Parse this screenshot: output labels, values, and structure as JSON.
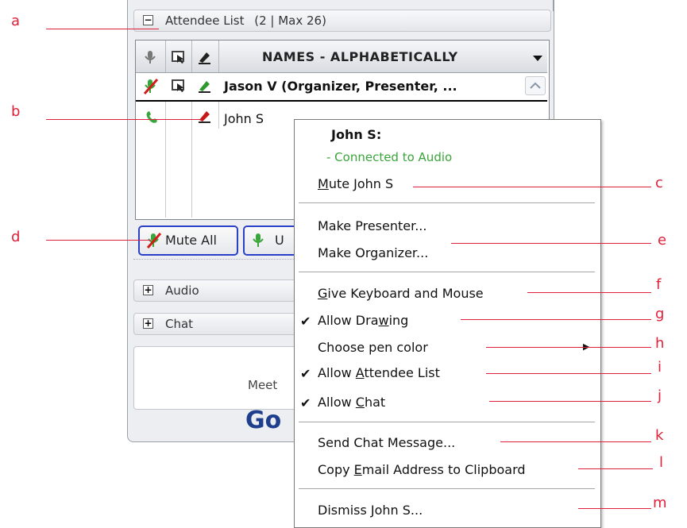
{
  "attendee_panel": {
    "section_title": "Attendee List",
    "count_text": "(2 | Max 26)",
    "collapse_symbol": "−",
    "columns": {
      "names_header": "NAMES - ALPHABETICALLY"
    },
    "rows": [
      {
        "name": "Jason V (Organizer, Presenter, ..."
      },
      {
        "name": "John S"
      }
    ],
    "buttons": {
      "mute_all": "Mute All",
      "unmute_partial": "U"
    },
    "sections": [
      {
        "label": "Audio",
        "symbol": "+"
      },
      {
        "label": "Chat",
        "symbol": "+"
      }
    ],
    "footer_text": "Meet",
    "brand_text": "Go"
  },
  "context_menu": {
    "title": "John S:",
    "status": "- Connected to Audio",
    "items": {
      "mute": {
        "pre": "",
        "ul": "M",
        "post": "ute John S"
      },
      "make_presenter": "Make Presenter...",
      "make_organizer": "Make Organizer...",
      "give_keyboard": {
        "pre": "",
        "ul": "G",
        "post": "ive Keyboard and Mouse"
      },
      "allow_drawing": {
        "pre": "Allow Dra",
        "ul": "w",
        "post": "ing",
        "checked": true
      },
      "choose_pen": "Choose pen color",
      "allow_attendee": {
        "pre": "Allow ",
        "ul": "A",
        "post": "ttendee List",
        "checked": true
      },
      "allow_chat": {
        "pre": "Allow ",
        "ul": "C",
        "post": "hat",
        "checked": true
      },
      "send_chat": "Send Chat Message...",
      "copy_email": {
        "pre": "Copy ",
        "ul": "E",
        "post": "mail Address to Clipboard"
      },
      "dismiss": "Dismiss John S..."
    },
    "check_glyph": "✔",
    "submenu_glyph": "▶"
  },
  "annotations": [
    "a",
    "b",
    "c",
    "d",
    "e",
    "f",
    "g",
    "h",
    "i",
    "j",
    "k",
    "l",
    "m"
  ],
  "colors": {
    "annotation": "#e0203a",
    "status_green": "#3aa53a",
    "brand_blue": "#1d3f8e",
    "button_border": "#2a40c8"
  }
}
